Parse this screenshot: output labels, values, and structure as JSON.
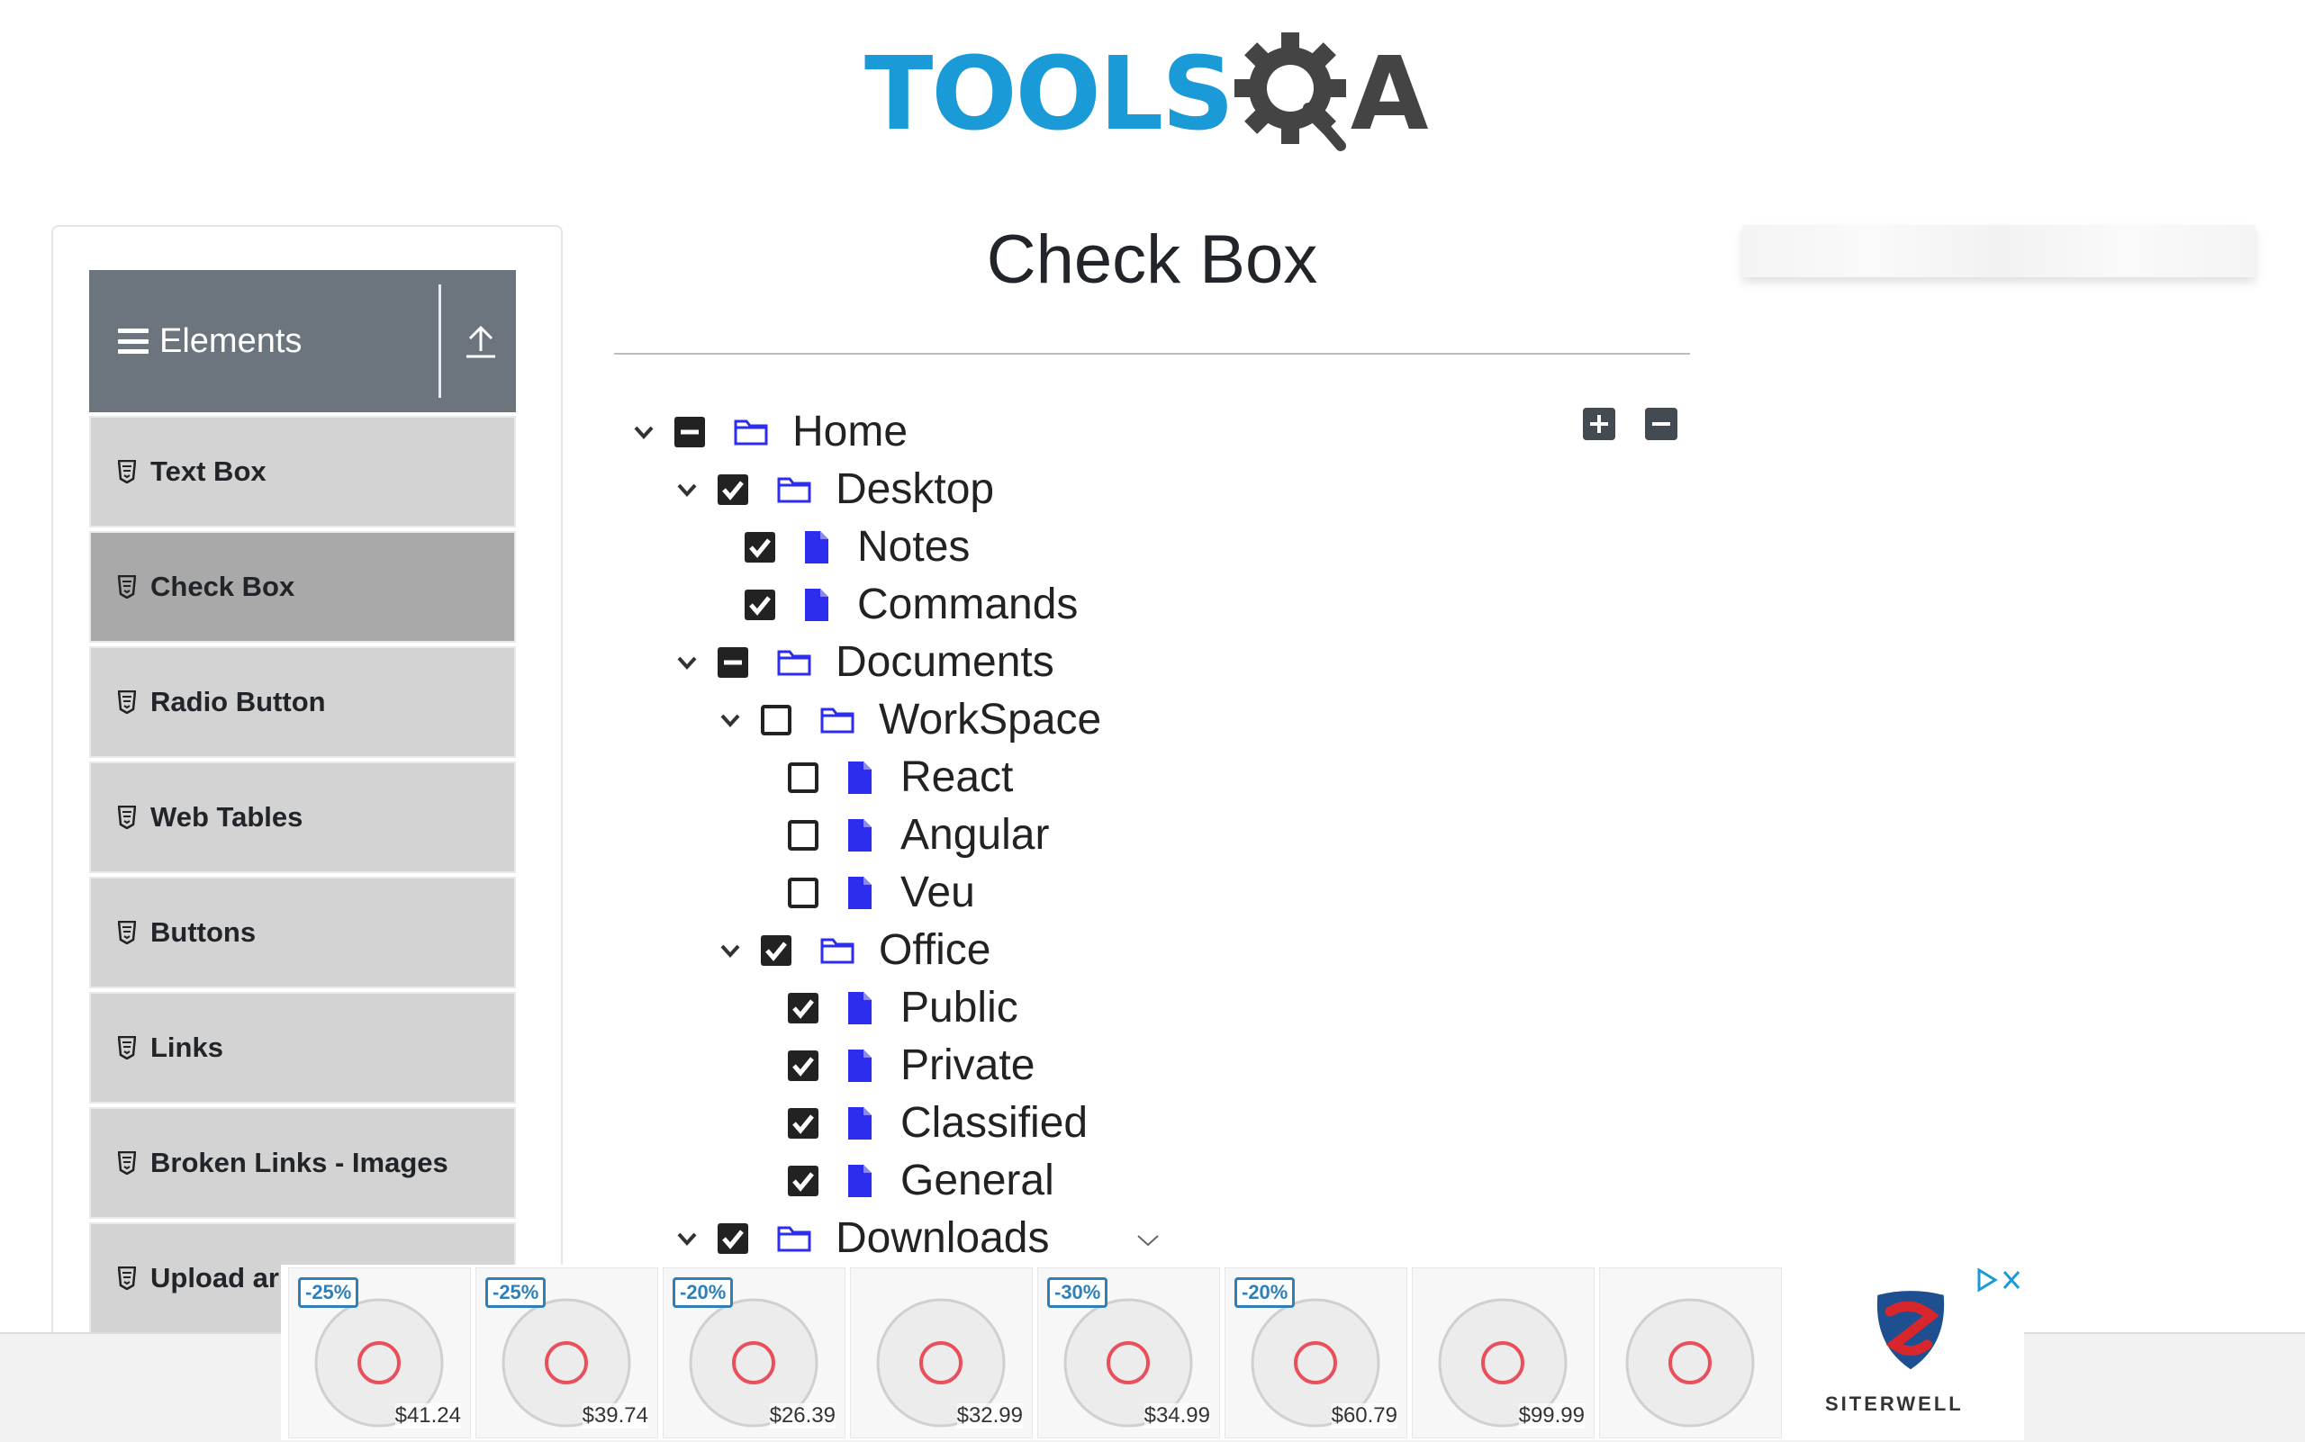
{
  "header": {
    "logo_text_left": "TOOLS",
    "logo_text_right": "A"
  },
  "sidebar": {
    "group_title": "Elements",
    "items": [
      {
        "label": "Text Box"
      },
      {
        "label": "Check Box",
        "active": true
      },
      {
        "label": "Radio Button"
      },
      {
        "label": "Web Tables"
      },
      {
        "label": "Buttons"
      },
      {
        "label": "Links"
      },
      {
        "label": "Broken Links - Images"
      },
      {
        "label": "Upload ar"
      }
    ]
  },
  "main": {
    "title": "Check Box",
    "tree": {
      "home": {
        "label": "Home",
        "state": "partial"
      },
      "desktop": {
        "label": "Desktop",
        "state": "checked"
      },
      "notes": {
        "label": "Notes",
        "state": "checked"
      },
      "commands": {
        "label": "Commands",
        "state": "checked"
      },
      "documents": {
        "label": "Documents",
        "state": "partial"
      },
      "workspace": {
        "label": "WorkSpace",
        "state": "unchecked"
      },
      "react": {
        "label": "React",
        "state": "unchecked"
      },
      "angular": {
        "label": "Angular",
        "state": "unchecked"
      },
      "veu": {
        "label": "Veu",
        "state": "unchecked"
      },
      "office": {
        "label": "Office",
        "state": "checked"
      },
      "public": {
        "label": "Public",
        "state": "checked"
      },
      "private": {
        "label": "Private",
        "state": "checked"
      },
      "classified": {
        "label": "Classified",
        "state": "checked"
      },
      "general": {
        "label": "General",
        "state": "checked"
      },
      "downloads": {
        "label": "Downloads",
        "state": "checked"
      }
    }
  },
  "ad": {
    "products": [
      {
        "badge": "-25%",
        "price": "$41.24"
      },
      {
        "badge": "-25%",
        "price": "$39.74"
      },
      {
        "badge": "-20%",
        "price": "$26.39"
      },
      {
        "badge": "",
        "price": "$32.99"
      },
      {
        "badge": "-30%",
        "price": "$34.99"
      },
      {
        "badge": "-20%",
        "price": "$60.79"
      },
      {
        "badge": "",
        "price": "$99.99"
      },
      {
        "badge": "",
        "price": ""
      }
    ],
    "brand": "SITERWELL"
  },
  "colors": {
    "accent_blue": "#1a9ad6",
    "folder_blue": "#2d2df0",
    "sidebar_header": "#6c757d"
  }
}
